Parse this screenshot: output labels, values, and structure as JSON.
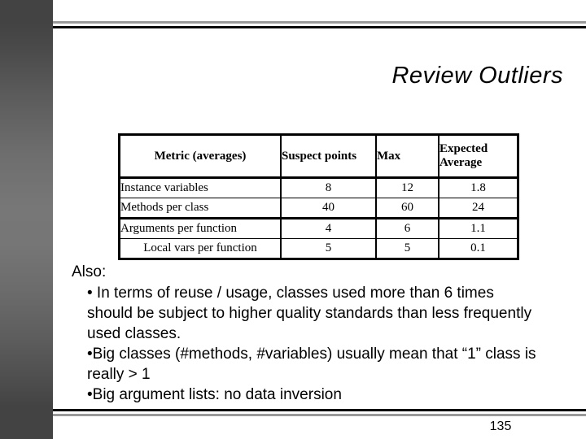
{
  "slide": {
    "title": "Review Outliers",
    "page_number": "135"
  },
  "table": {
    "headers": {
      "metric": "Metric (averages)",
      "suspect": "Suspect points",
      "max": "Max",
      "expected_average": "Expected Average"
    },
    "rows": [
      {
        "metric": "Instance variables",
        "suspect": "8",
        "max": "12",
        "expected_average": "1.8"
      },
      {
        "metric": "Methods per class",
        "suspect": "40",
        "max": "60",
        "expected_average": "24"
      },
      {
        "metric": "Arguments per function",
        "suspect": "4",
        "max": "6",
        "expected_average": "1.1"
      },
      {
        "metric": "Local vars per function",
        "suspect": "5",
        "max": "5",
        "expected_average": "0.1"
      }
    ]
  },
  "body": {
    "lead": "Also:",
    "bullet_glyph": "•",
    "bullets": [
      " In terms of reuse / usage, classes used more than 6 times should be subject to higher quality standards than less frequently used classes.",
      "Big classes (#methods, #variables) usually mean that “1” class is really > 1",
      "Big argument lists: no data inversion"
    ]
  },
  "colors": {
    "sidebar_dark": "#434343",
    "sidebar_light": "#777777",
    "rule_gray": "#999999",
    "rule_black": "#000000",
    "text": "#000000",
    "background": "#ffffff"
  }
}
